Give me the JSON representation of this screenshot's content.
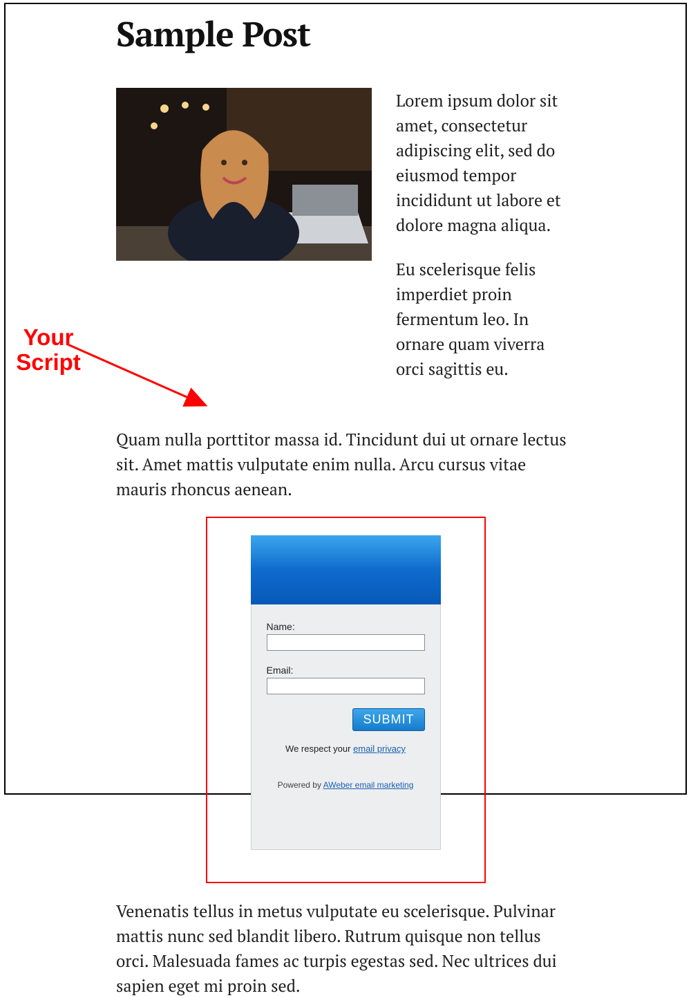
{
  "post": {
    "title": "Sample Post",
    "lead1": "Lorem ipsum dolor sit amet, consectetur adipiscing elit, sed do eiusmod tempor incididunt ut labore et dolore magna aliqua.",
    "lead2": "Eu scelerisque felis imperdiet proin fermentum leo. In ornare quam viverra orci sagittis eu.",
    "para1": "Quam nulla porttitor massa id. Tincidunt dui ut ornare lectus sit. Amet mattis vulputate enim nulla. Arcu cursus vitae mauris rhoncus aenean.",
    "para2": "Venenatis tellus in metus vulputate eu scelerisque. Pulvinar mattis nunc sed blandit libero. Rutrum quisque non tellus orci. Malesuada fames ac turpis egestas sed. Nec ultrices dui sapien eget mi proin sed."
  },
  "annotation": {
    "line1": "Your",
    "line2": "Script"
  },
  "form": {
    "name_label": "Name:",
    "email_label": "Email:",
    "submit_label": "SUBMIT",
    "respect_prefix": "We respect your ",
    "respect_link": "email privacy",
    "powered_prefix": "Powered by ",
    "powered_link": "AWeber email marketing"
  }
}
